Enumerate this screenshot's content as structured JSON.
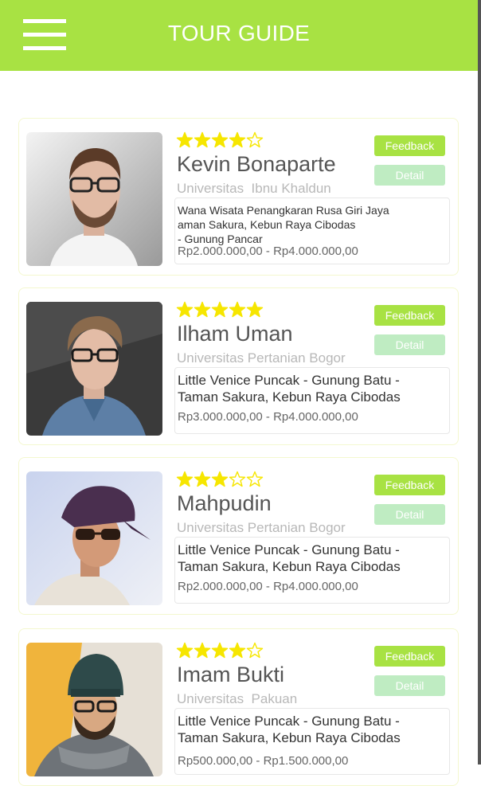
{
  "header": {
    "title": "TOUR GUIDE"
  },
  "colors": {
    "accent": "#a8e243",
    "detail": "#bfecc2",
    "star": "#f6e600"
  },
  "guides": [
    {
      "rating": 4,
      "name": "Kevin Bonaparte",
      "university": "Universitas  Ibnu Khaldun",
      "route": "Wana Wisata Penangkaran Rusa Giri Jaya\n aman Sakura, Kebun Raya Cibodas\n- Gunung Pancar",
      "price": "Rp2.000.000,00 - Rp4.000.000,00",
      "feedback_label": "Feedback",
      "detail_label": "Detail"
    },
    {
      "rating": 5,
      "name": "Ilham Uman",
      "university": "Universitas Pertanian Bogor",
      "route": "Little Venice Puncak - Gunung Batu -\nTaman Sakura, Kebun Raya Cibodas",
      "price": "Rp3.000.000,00 - Rp4.000.000,00",
      "feedback_label": "Feedback",
      "detail_label": "Detail"
    },
    {
      "rating": 3,
      "name": "Mahpudin",
      "university": "Universitas Pertanian Bogor",
      "route": "Little Venice Puncak - Gunung Batu -\nTaman Sakura, Kebun Raya Cibodas",
      "price": "Rp2.000.000,00 - Rp4.000.000,00",
      "feedback_label": "Feedback",
      "detail_label": "Detail"
    },
    {
      "rating": 4,
      "name": "Imam Bukti",
      "university": "Universitas  Pakuan",
      "route": "Little Venice Puncak - Gunung Batu -\nTaman Sakura, Kebun Raya Cibodas",
      "price": "Rp500.000,00 - Rp1.500.000,00",
      "feedback_label": "Feedback",
      "detail_label": "Detail"
    }
  ]
}
